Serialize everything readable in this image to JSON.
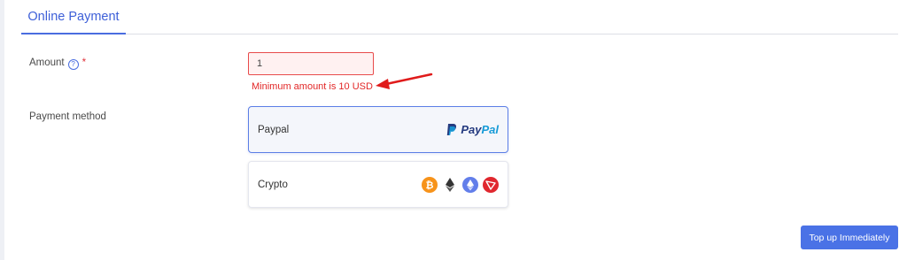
{
  "tabs": [
    {
      "label": "Online Payment"
    }
  ],
  "form": {
    "amount": {
      "label": "Amount",
      "help_icon": "question-circle-icon",
      "required_marker": "*",
      "value": "1",
      "error": "Minimum amount is 10 USD"
    },
    "payment_method": {
      "label": "Payment method",
      "options": [
        {
          "name": "Paypal",
          "logo_text": "PayPal",
          "selected": true
        },
        {
          "name": "Crypto",
          "icons": [
            "bitcoin-icon",
            "ethereum-icon",
            "ethereum-blue-icon",
            "tron-icon"
          ],
          "selected": false
        }
      ]
    }
  },
  "actions": {
    "topup_label": "Top up Immediately"
  },
  "colors": {
    "accent": "#4a6de0",
    "error": "#e22727",
    "button": "#4a72e6"
  }
}
